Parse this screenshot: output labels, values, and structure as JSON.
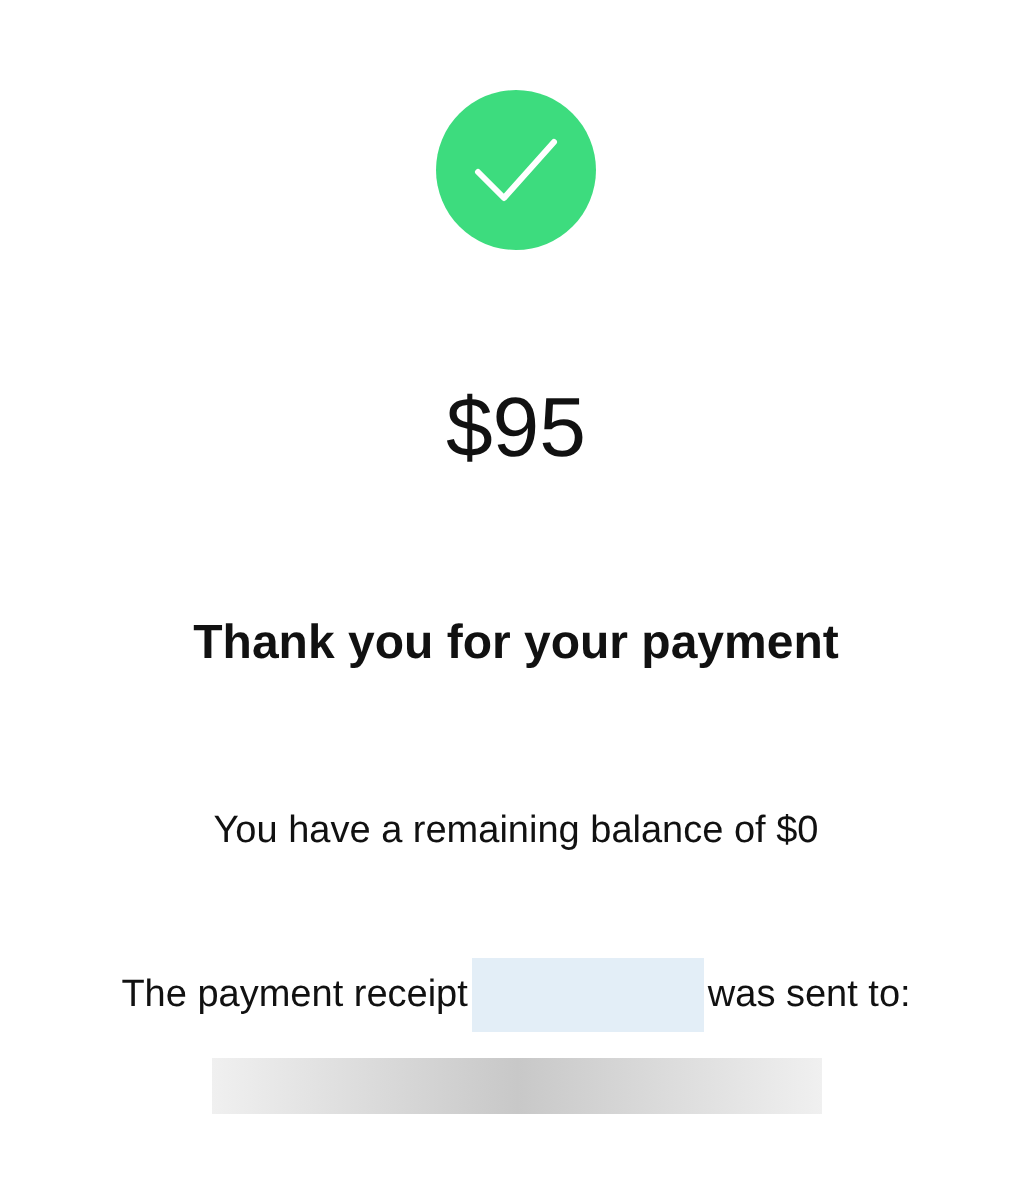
{
  "amount": "$95",
  "heading": "Thank you for your payment",
  "balance_text": "You have a remaining balance of $0",
  "receipt": {
    "before": "The payment receipt",
    "after": "was sent to:"
  }
}
